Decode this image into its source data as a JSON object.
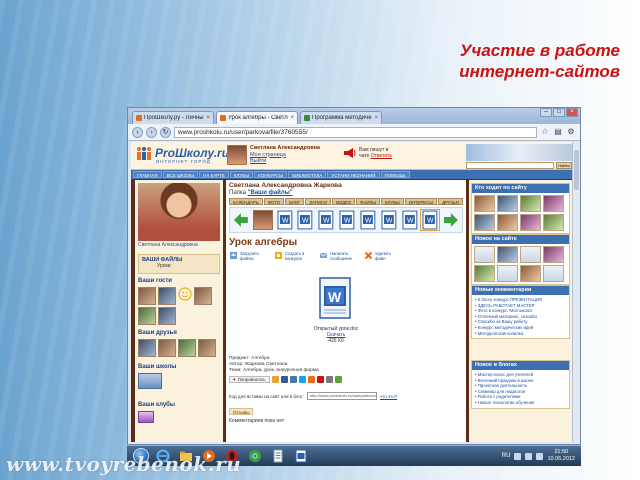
{
  "slide": {
    "title_line1": "Участие в  работе",
    "title_line2": "интернет-сайтов",
    "watermark": "www.tvoyrebenok.ru"
  },
  "browser": {
    "tabs": [
      {
        "label": "ПроШколу.ру - Личный блог",
        "active": false
      },
      {
        "label": "Урок алгебры - Светлана",
        "active": true
      },
      {
        "label": "Программа методического",
        "active": false
      }
    ],
    "url": "www.proshkolu.ru/user/parkova/file/3760555/"
  },
  "site": {
    "logo_main": "ProШколу.ru",
    "logo_sub": "ИНТЕРНЕТ-ГОРОД",
    "user_name": "Светлана Александровна",
    "user_link1": "Моя страница",
    "user_link2": "Выйти",
    "notice_line1": "Вам пишут в",
    "notice_line2": "чате",
    "notice_link": "Ответить",
    "search_button": "Найти",
    "nav": [
      "ГЛАВНАЯ",
      "ВСЕ ШКОЛЫ",
      "НА КАРТЕ",
      "КЛУБЫ",
      "КОНКУРСЫ",
      "БИБЛИОТЕКА",
      "УСТАНИ НЕЗНАНИЙ",
      "ПОМОЩЬ"
    ]
  },
  "left": {
    "profile_name": "Светлана Александровна",
    "files_heading": "ВАШИ ФАЙЛЫ",
    "files_sub": "Уроки",
    "guests_heading": "Ваши гости",
    "friends_heading": "Ваши друзья",
    "schools_heading": "Ваши школы",
    "clubs_heading": "Ваши клубы"
  },
  "center": {
    "owner_name": "Светлана Александровна Жаркова",
    "folder_prefix": "Папка",
    "folder_name": "\"Ваши файлы\"",
    "tabs": [
      "КАЛЕНДАРЬ",
      "ФОТО",
      "БЛОГ",
      "ЗАПИСИ",
      "ВИДЕО",
      "ФАЙЛЫ",
      "КЛУБЫ",
      "ИНТЕРЕСЫ",
      "ДРУЗЬЯ"
    ],
    "lesson_title": "Урок алгебры",
    "actions": [
      "Загрузить файлы",
      "Создать в конкурсе",
      "Написать сообщение",
      "Удалить файл"
    ],
    "file_name": "Открытый урок.doc",
    "file_download": "Скачать",
    "file_size": "426 Кб",
    "meta_line1": "Предмет: Алгебра",
    "meta_line2": "Автор: Жаркова Светлана",
    "meta_line3": "Тема: Алгебра, урок, внеурочная форма",
    "share_label": "Понравилось",
    "code_label": "Код для вставки на сайт или в блог:",
    "code_value": "http://www.proshkolu.ru/user/parkova",
    "code_link": "что это?",
    "reviews_tab": "Отзывы",
    "comments_label": "Комментариев пока нет"
  },
  "right": {
    "who_heading": "Кто ходит по сайту",
    "new_heading": "Новое на сайте",
    "comments_heading": "Новые комментарии",
    "comments": [
      "К блогу конкурс ПРЕЗЕНТАЦИЯ",
      "ЗДЕСЬ РАБОТАЕТ МАСТЕР",
      "Фото в конкурс 'Моя школа'",
      "Отличный материал, спасибо",
      "Спасибо за Вашу работу",
      "Конкурс методических идей",
      "Методическая копилка"
    ],
    "blogs_heading": "Новое в блогах",
    "blogs": [
      "Мастер-класс для учителей",
      "Весенний праздник в школе",
      "Проектная деятельность",
      "Семинар для педагогов",
      "Работа с родителями",
      "Новые технологии обучения"
    ]
  },
  "taskbar": {
    "lang": "RU",
    "time": "21:50",
    "date": "10.06.2012"
  },
  "colors": {
    "title_red": "#cc1111",
    "site_blue": "#3d6fb3",
    "site_brown": "#5b2c16"
  }
}
